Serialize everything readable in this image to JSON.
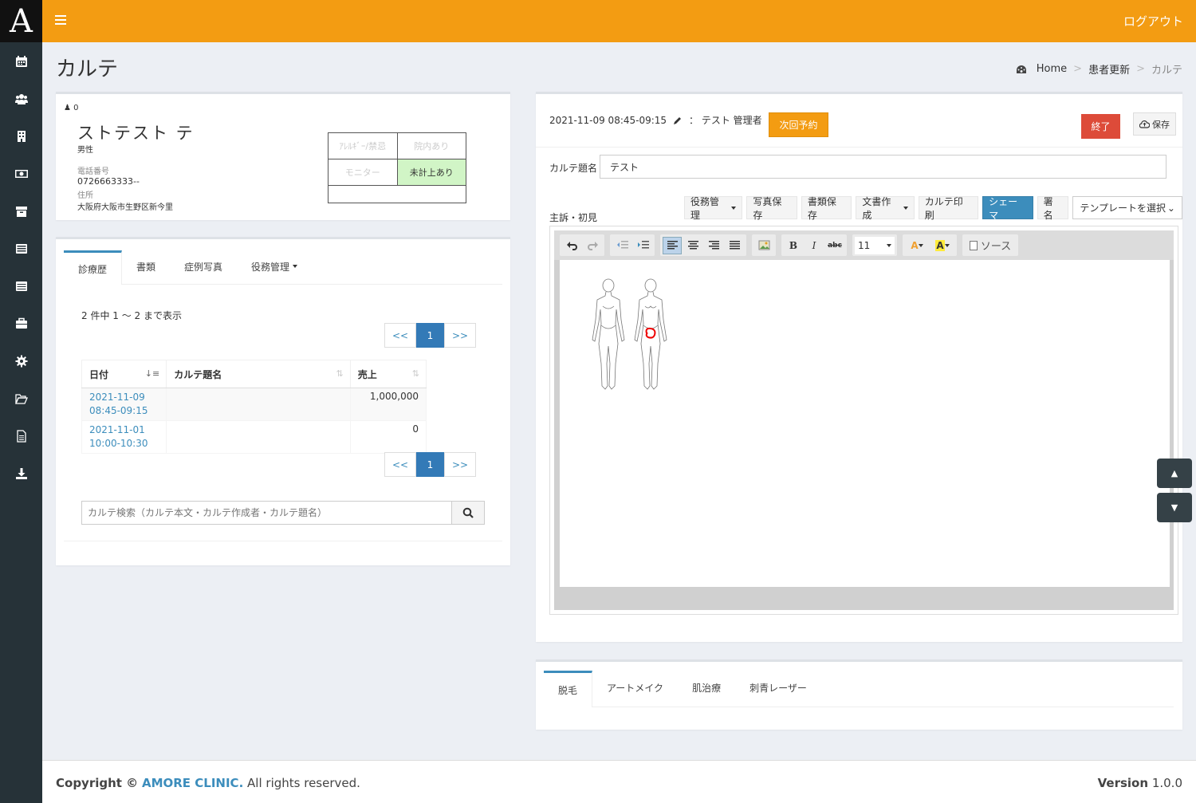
{
  "app": {
    "logo_letter": "A",
    "logout_label": "ログアウト"
  },
  "sidebar": {
    "items": [
      {
        "icon": "calendar-icon"
      },
      {
        "icon": "users-icon"
      },
      {
        "icon": "building-icon"
      },
      {
        "icon": "money-icon"
      },
      {
        "icon": "archive-icon"
      },
      {
        "icon": "list-icon"
      },
      {
        "icon": "table-icon"
      },
      {
        "icon": "briefcase-icon"
      },
      {
        "icon": "gear-icon"
      },
      {
        "icon": "folder-open-icon"
      },
      {
        "icon": "document-icon"
      },
      {
        "icon": "download-icon"
      }
    ]
  },
  "page": {
    "title": "カルテ"
  },
  "breadcrumb": {
    "home": "Home",
    "sep": ">",
    "item1": "患者更新",
    "current": "カルテ"
  },
  "patient": {
    "id": "0",
    "name": "ストテスト テ",
    "sex": "男性",
    "tel_label": "電話番号",
    "tel": "0726663333--",
    "addr_label": "住所",
    "addr": "大阪府大阪市生野区新今里",
    "flags": {
      "allergy": "ｱﾚﾙｷﾞｰ/禁忌",
      "in_clinic": "院内あり",
      "monitor": "モニター",
      "unpaid": "未計上あり"
    }
  },
  "history": {
    "tabs": [
      "診療歴",
      "書類",
      "症例写真",
      "役務管理"
    ],
    "count_text": "2 件中 1 ～ 2 まで表示",
    "pager": {
      "prev": "<<",
      "page": "1",
      "next": ">>"
    },
    "columns": {
      "date": "日付",
      "title": "カルテ題名",
      "sales": "売上"
    },
    "rows": [
      {
        "date": "2021-11-09",
        "time": "08:45-09:15",
        "title": "",
        "sales": "1,000,000"
      },
      {
        "date": "2021-11-01",
        "time": "10:00-10:30",
        "title": "",
        "sales": "0"
      }
    ],
    "search_placeholder": "カルテ検索（カルテ本文・カルテ作成者・カルテ題名）"
  },
  "karte": {
    "visit_time": "2021-11-09 08:45-09:15",
    "author": "：  テスト 管理者",
    "next_button": "次回予約",
    "end_button": "終了",
    "save_button": "保存",
    "title_label": "カルテ題名",
    "title_value": "テスト",
    "complaint_label": "主訴・初見",
    "actions": {
      "service": "役務管理",
      "photo_save": "写真保存",
      "doc_save": "書類保存",
      "doc_create": "文書作成",
      "print": "カルテ印刷",
      "schema": "シェーマ",
      "sign": "署名",
      "template": "テンプレートを選択"
    },
    "editor": {
      "font_size": "11",
      "source_label": "ソース",
      "bold": "B",
      "italic": "I",
      "strike": "abc"
    }
  },
  "scroll": {
    "up": "▲",
    "down": "▼"
  },
  "treatments": {
    "tabs": [
      "脱毛",
      "アートメイク",
      "肌治療",
      "刺青レーザー"
    ]
  },
  "footer": {
    "copyright_prefix": "Copyright ©",
    "brand": "AMORE CLINIC.",
    "rights": "All rights reserved.",
    "version_label": "Version",
    "version": "1.0.0"
  },
  "colors": {
    "header": "#f39c12",
    "sidebar": "#263238",
    "primary": "#3c8dbc",
    "danger": "#dd4b39"
  }
}
